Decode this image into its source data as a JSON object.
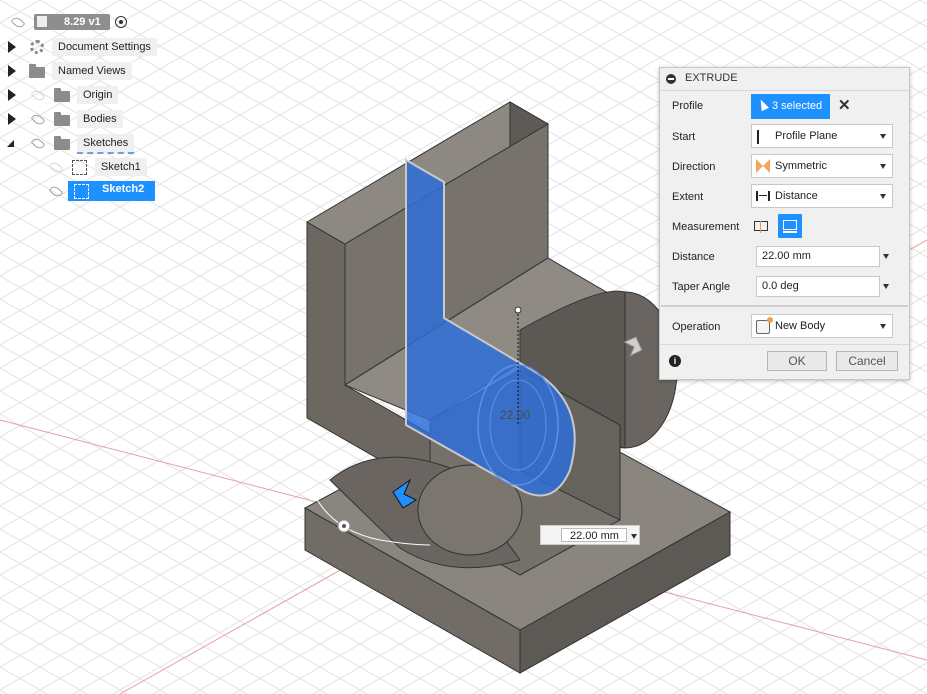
{
  "browser": {
    "document_version": "8.29 v1",
    "items": [
      {
        "label": "Document Settings"
      },
      {
        "label": "Named Views"
      },
      {
        "label": "Origin"
      },
      {
        "label": "Bodies"
      },
      {
        "label": "Sketches"
      }
    ],
    "sketches": [
      {
        "label": "Sketch1",
        "selected": false
      },
      {
        "label": "Sketch2",
        "selected": true
      }
    ]
  },
  "viewport": {
    "dimension_label": "22.00",
    "distance_input_value": "22.00 mm"
  },
  "extrude_dialog": {
    "title": "EXTRUDE",
    "profile_label": "Profile",
    "profile_value": "3 selected",
    "start_label": "Start",
    "start_value": "Profile Plane",
    "direction_label": "Direction",
    "direction_value": "Symmetric",
    "extent_label": "Extent",
    "extent_value": "Distance",
    "measurement_label": "Measurement",
    "distance_label": "Distance",
    "distance_value": "22.00 mm",
    "taper_label": "Taper Angle",
    "taper_value": "0.0 deg",
    "operation_label": "Operation",
    "operation_value": "New Body",
    "ok_label": "OK",
    "cancel_label": "Cancel"
  },
  "colors": {
    "selection_blue": "#1e90ff",
    "profile_blue": "#2f6fd8",
    "body_gray": "#6f6a63",
    "grid_line": "#e4e4e4"
  }
}
